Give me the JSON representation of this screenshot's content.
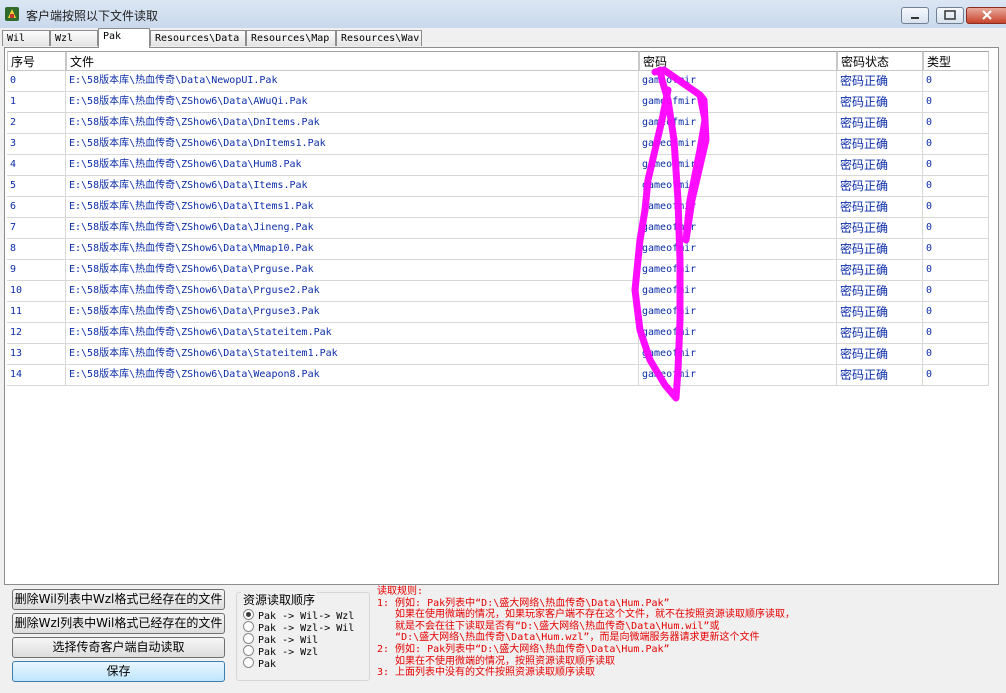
{
  "window": {
    "title": "客户端按照以下文件读取"
  },
  "tabs": [
    "Wil",
    "Wzl",
    "Pak",
    "Resources\\Data",
    "Resources\\Map",
    "Resources\\Wav"
  ],
  "active_tab": 2,
  "table": {
    "headers": [
      "序号",
      "文件",
      "密码",
      "密码状态",
      "类型"
    ],
    "rows": [
      [
        "0",
        "E:\\58版本库\\热血传奇\\Data\\NewopUI.Pak",
        "gameofmir",
        "密码正确",
        "0"
      ],
      [
        "1",
        "E:\\58版本库\\热血传奇\\ZShow6\\Data\\AWuQi.Pak",
        "gameofmir",
        "密码正确",
        "0"
      ],
      [
        "2",
        "E:\\58版本库\\热血传奇\\ZShow6\\Data\\DnItems.Pak",
        "gameofmir",
        "密码正确",
        "0"
      ],
      [
        "3",
        "E:\\58版本库\\热血传奇\\ZShow6\\Data\\DnItems1.Pak",
        "gameofmir",
        "密码正确",
        "0"
      ],
      [
        "4",
        "E:\\58版本库\\热血传奇\\ZShow6\\Data\\Hum8.Pak",
        "gameofmir",
        "密码正确",
        "0"
      ],
      [
        "5",
        "E:\\58版本库\\热血传奇\\ZShow6\\Data\\Items.Pak",
        "gameofmir",
        "密码正确",
        "0"
      ],
      [
        "6",
        "E:\\58版本库\\热血传奇\\ZShow6\\Data\\Items1.Pak",
        "gameofmir",
        "密码正确",
        "0"
      ],
      [
        "7",
        "E:\\58版本库\\热血传奇\\ZShow6\\Data\\Jineng.Pak",
        "gameofmir",
        "密码正确",
        "0"
      ],
      [
        "8",
        "E:\\58版本库\\热血传奇\\ZShow6\\Data\\Mmap10.Pak",
        "gameofmir",
        "密码正确",
        "0"
      ],
      [
        "9",
        "E:\\58版本库\\热血传奇\\ZShow6\\Data\\Prguse.Pak",
        "gameofmir",
        "密码正确",
        "0"
      ],
      [
        "10",
        "E:\\58版本库\\热血传奇\\ZShow6\\Data\\Prguse2.Pak",
        "gameofmir",
        "密码正确",
        "0"
      ],
      [
        "11",
        "E:\\58版本库\\热血传奇\\ZShow6\\Data\\Prguse3.Pak",
        "gameofmir",
        "密码正确",
        "0"
      ],
      [
        "12",
        "E:\\58版本库\\热血传奇\\ZShow6\\Data\\Stateitem.Pak",
        "gameofmir",
        "密码正确",
        "0"
      ],
      [
        "13",
        "E:\\58版本库\\热血传奇\\ZShow6\\Data\\Stateitem1.Pak",
        "gameofmir",
        "密码正确",
        "0"
      ],
      [
        "14",
        "E:\\58版本库\\热血传奇\\ZShow6\\Data\\Weapon8.Pak",
        "gameofmir",
        "密码正确",
        "0"
      ]
    ]
  },
  "buttons": {
    "delete_wzl": "删除Wil列表中Wzl格式已经存在的文件",
    "delete_wil": "删除Wzl列表中Wil格式已经存在的文件",
    "auto_read": "选择传奇客户端自动读取",
    "save": "保存"
  },
  "read_order": {
    "title": "资源读取顺序",
    "options": [
      "Pak -> Wil-> Wzl",
      "Pak -> Wzl-> Wil",
      "Pak -> Wil",
      "Pak -> Wzl",
      "Pak"
    ],
    "selected": 0
  },
  "rules": [
    "读取规则:",
    "1: 例如: Pak列表中“D:\\盛大网络\\热血传奇\\Data\\Hum.Pak”",
    "   如果在使用微端的情况，如果玩家客户端不存在这个文件，就不在按照资源读取顺序读取，",
    "   就是不会在往下读取是否有“D:\\盛大网络\\热血传奇\\Data\\Hum.wil”或",
    "   “D:\\盛大网络\\热血传奇\\Data\\Hum.wzl”，而是向微端服务器请求更新这个文件",
    "2: 例如: Pak列表中“D:\\盛大网络\\热血传奇\\Data\\Hum.Pak”",
    "   如果在不使用微端的情况，按照资源读取顺序读取",
    "3: 上面列表中没有的文件按照资源读取顺序读取"
  ],
  "colors": {
    "link_blue": "#0b2da8",
    "rules_red": "#e60000",
    "scribble": "#ff00ff"
  }
}
